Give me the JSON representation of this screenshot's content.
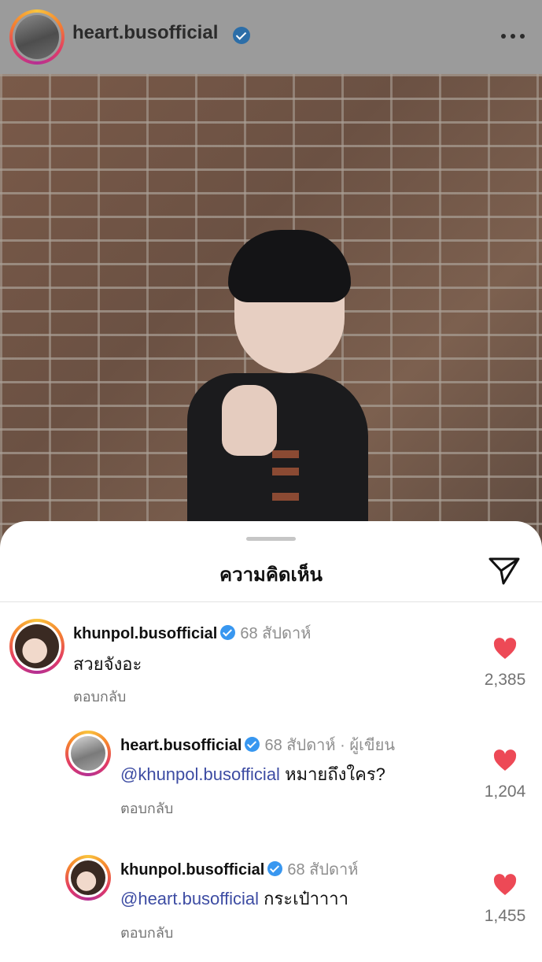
{
  "header": {
    "username": "heart.busofficial",
    "icons": [
      "avatar",
      "verified-badge-icon",
      "more-options-icon"
    ]
  },
  "sheet": {
    "title": "ความคิดเห็น",
    "share_icon": "paper-plane-icon"
  },
  "comments": [
    {
      "username": "khunpol.busofficial",
      "time": "68 สัปดาห์",
      "author_tag": "",
      "mention": "",
      "text": "สวยจังอะ",
      "reply_label": "ตอบกลับ",
      "likes": "2,385"
    },
    {
      "username": "heart.busofficial",
      "time": "68 สัปดาห์",
      "author_tag": "· ผู้เขียน",
      "mention": "@khunpol.busofficial",
      "text": " หมายถึงใคร?",
      "reply_label": "ตอบกลับ",
      "likes": "1,204"
    },
    {
      "username": "khunpol.busofficial",
      "time": "68 สัปดาห์",
      "author_tag": "",
      "mention": "@heart.busofficial",
      "text": " กระเป๋าาาา",
      "reply_label": "ตอบกลับ",
      "likes": "1,455"
    }
  ],
  "colors": {
    "verified": "#3897f0",
    "heart": "#ed4956",
    "mention": "#3d4ca3"
  }
}
